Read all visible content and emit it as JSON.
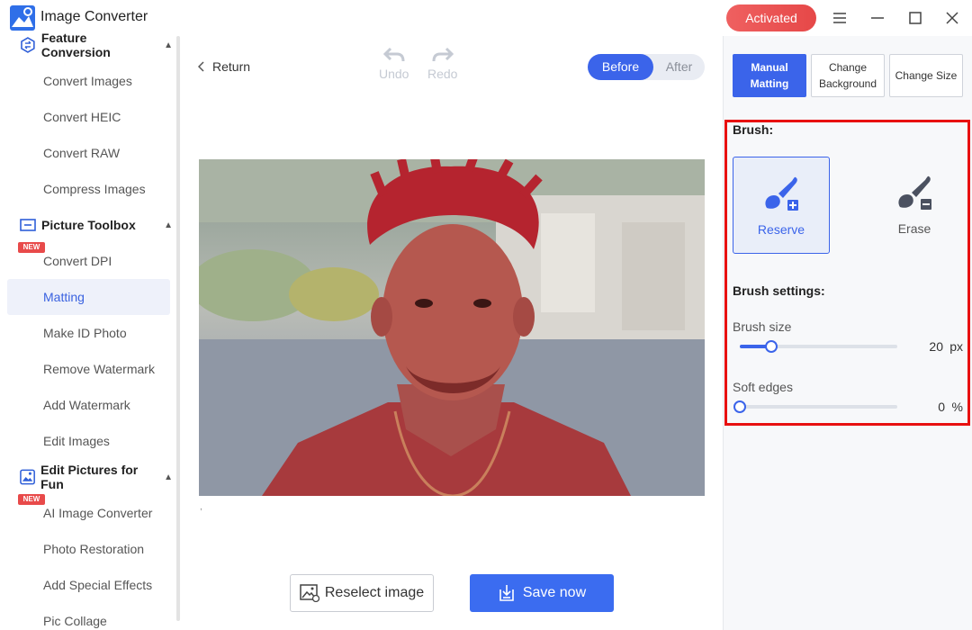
{
  "app": {
    "title": "Image Converter",
    "activated_label": "Activated"
  },
  "sidebar": {
    "groups": [
      {
        "label": "Feature Conversion"
      },
      {
        "label": "Picture Toolbox"
      },
      {
        "label": "Edit Pictures for Fun"
      }
    ],
    "items": [
      {
        "label": "Convert Images"
      },
      {
        "label": "Convert HEIC"
      },
      {
        "label": "Convert RAW"
      },
      {
        "label": "Compress Images"
      },
      {
        "label": "Convert DPI",
        "badge": "NEW"
      },
      {
        "label": "Matting",
        "active": true
      },
      {
        "label": "Make ID Photo"
      },
      {
        "label": "Remove Watermark"
      },
      {
        "label": "Add Watermark"
      },
      {
        "label": "Edit Images"
      },
      {
        "label": "AI Image Converter",
        "badge": "NEW"
      },
      {
        "label": "Photo Restoration"
      },
      {
        "label": "Add Special Effects"
      },
      {
        "label": "Pic Collage"
      }
    ]
  },
  "toolbar": {
    "return_label": "Return",
    "undo_label": "Undo",
    "redo_label": "Redo",
    "toggle": {
      "before": "Before",
      "after": "After",
      "selected": "Before"
    }
  },
  "canvas": {
    "caption_mark": ","
  },
  "actions": {
    "reselect_label": "Reselect image",
    "save_label": "Save now"
  },
  "right_panel": {
    "tabs": [
      {
        "label": "Manual Matting",
        "active": true
      },
      {
        "label": "Change Background"
      },
      {
        "label": "Change Size"
      }
    ],
    "brush_heading": "Brush:",
    "brushes": [
      {
        "label": "Reserve",
        "active": true
      },
      {
        "label": "Erase"
      }
    ],
    "settings_heading": "Brush settings:",
    "brush_size": {
      "label": "Brush size",
      "value": "20",
      "unit": "px",
      "fraction": 0.2
    },
    "soft_edges": {
      "label": "Soft edges",
      "value": "0",
      "unit": "%",
      "fraction": 0
    }
  },
  "colors": {
    "accent": "#3b64ea",
    "highlight_border": "#e81010",
    "activated": "#e64848"
  }
}
